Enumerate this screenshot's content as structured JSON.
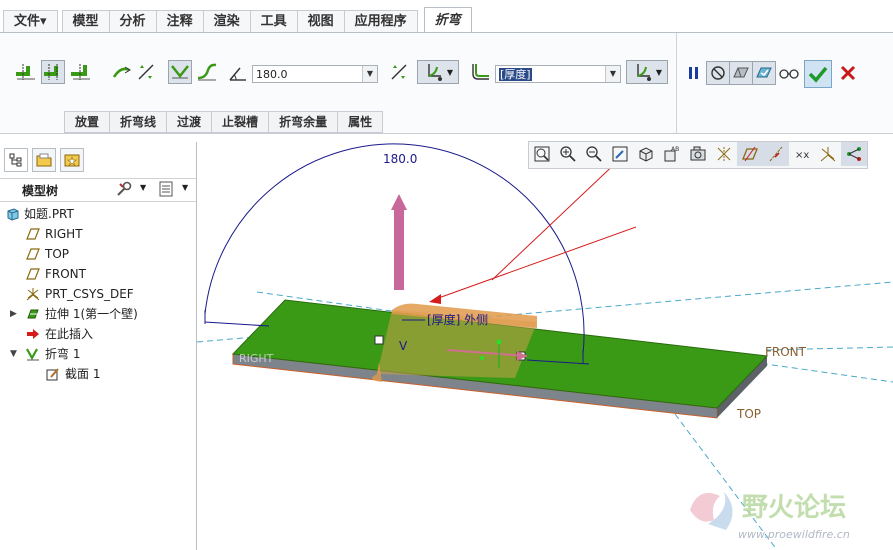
{
  "menu": {
    "file": "文件▾",
    "tabs": [
      "模型",
      "分析",
      "注释",
      "渲染",
      "工具",
      "视图",
      "应用程序"
    ],
    "active_tab": "折弯"
  },
  "ribbon": {
    "angle_value": "180.0",
    "thickness_value": "[厚度]",
    "sub_tabs": [
      "放置",
      "折弯线",
      "过渡",
      "止裂槽",
      "折弯余量",
      "属性"
    ]
  },
  "model_tree": {
    "title": "模型树",
    "items": [
      {
        "label": "如题.PRT"
      },
      {
        "label": "RIGHT"
      },
      {
        "label": "TOP"
      },
      {
        "label": "FRONT"
      },
      {
        "label": "PRT_CSYS_DEF"
      },
      {
        "label": "拉伸 1(第一个壁)"
      },
      {
        "label": "在此插入"
      },
      {
        "label": "折弯 1"
      },
      {
        "label": "截面 1"
      }
    ]
  },
  "graphics": {
    "angle_dim": "180.0",
    "callout": "[厚度] 外侧",
    "plane_front": "FRONT",
    "plane_top": "TOP",
    "plane_right": "RIGHT",
    "v_label": "V"
  },
  "watermark": {
    "title": "野火论坛",
    "url": "www.proewildfire.cn"
  },
  "colors": {
    "part_green": "#3a9a16",
    "part_side": "#808890",
    "dim_blue": "#1a1a8c",
    "arrow_red": "#d61b1b",
    "accent_pink": "#c8679a",
    "datum_cyan": "#4aa8c8"
  }
}
